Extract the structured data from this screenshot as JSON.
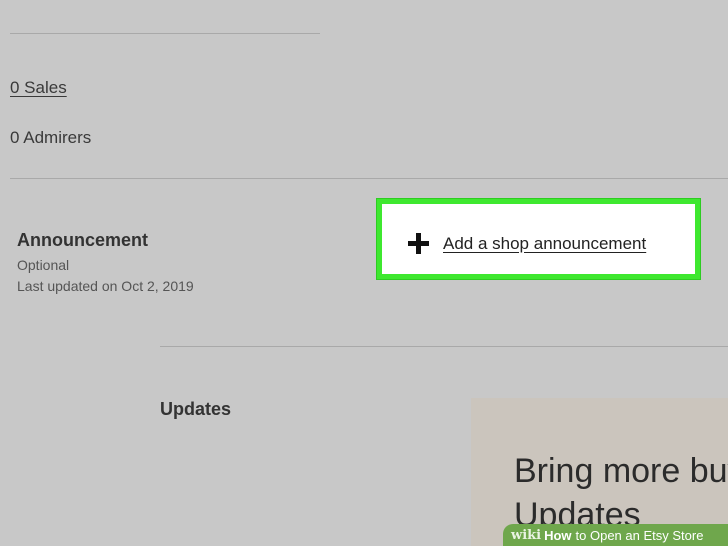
{
  "stats": {
    "sales_label": "0 Sales",
    "admirers_label": "0 Admirers"
  },
  "announcement": {
    "title": "Announcement",
    "optional_label": "Optional",
    "last_updated": "Last updated on Oct 2, 2019",
    "add_link_label": "Add a shop announcement",
    "add_icon": "plus-icon",
    "highlight_color": "#3ee82f"
  },
  "updates": {
    "title": "Updates",
    "promo_line1": "Bring more buy",
    "promo_line2": "Updates"
  },
  "watermark": {
    "wiki": "wiki",
    "how": "How",
    "title": "to Open an Etsy Store",
    "color": "#6fa74c"
  }
}
